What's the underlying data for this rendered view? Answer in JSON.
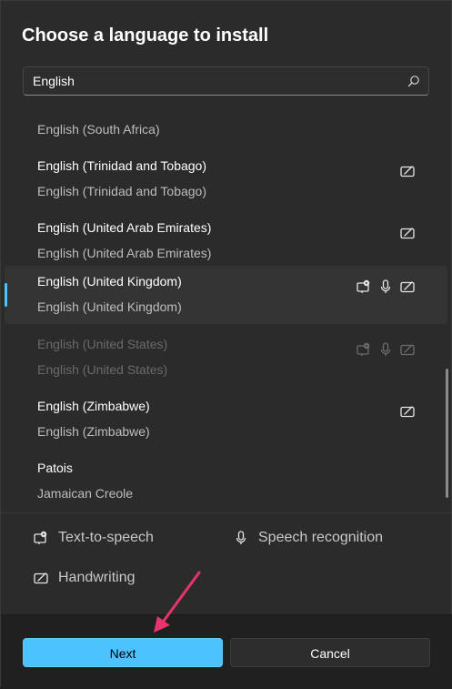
{
  "dialog": {
    "title": "Choose a language to install"
  },
  "search": {
    "value": "English",
    "placeholder": ""
  },
  "languages": [
    {
      "name": "",
      "native": "English (South Africa)"
    },
    {
      "name": "English (Trinidad and Tobago)",
      "native": "English (Trinidad and Tobago)",
      "features": [
        "handwriting"
      ]
    },
    {
      "name": "English (United Arab Emirates)",
      "native": "English (United Arab Emirates)",
      "features": [
        "handwriting"
      ]
    },
    {
      "name": "English (United Kingdom)",
      "native": "English (United Kingdom)",
      "features": [
        "text-to-speech",
        "speech-recognition",
        "handwriting"
      ],
      "selected": true
    },
    {
      "name": "English (United States)",
      "native": "English (United States)",
      "features": [
        "text-to-speech",
        "speech-recognition",
        "handwriting"
      ],
      "disabled": true
    },
    {
      "name": "English (Zimbabwe)",
      "native": "English (Zimbabwe)",
      "features": [
        "handwriting"
      ]
    },
    {
      "name": "Patois",
      "native": "Jamaican Creole",
      "features": []
    }
  ],
  "legend": {
    "tts": "Text-to-speech",
    "speech": "Speech recognition",
    "handwriting": "Handwriting"
  },
  "buttons": {
    "next": "Next",
    "cancel": "Cancel"
  },
  "colors": {
    "accent": "#4cc2ff",
    "annotation_arrow": "#e8336b"
  }
}
